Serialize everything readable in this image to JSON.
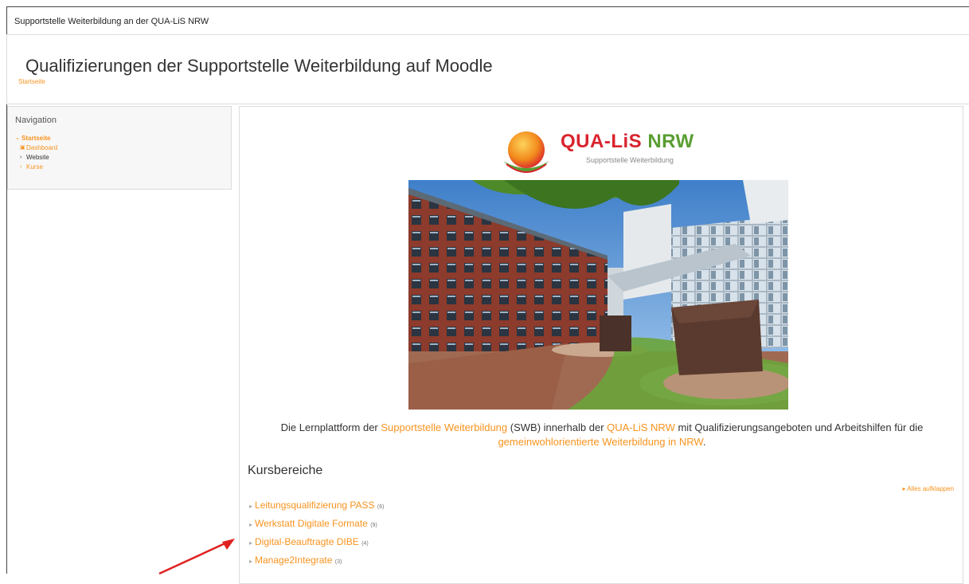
{
  "site_name": "Supportstelle Weiterbildung an der QUA-LiS NRW",
  "page_title": "Qualifizierungen der Supportstelle Weiterbildung auf Moodle",
  "breadcrumb": [
    "Startseite"
  ],
  "navigation": {
    "title": "Navigation",
    "items": [
      {
        "label": "Startseite",
        "glyph": "chevron-down-icon"
      },
      {
        "label": "Dashboard",
        "glyph": "dashboard-icon"
      },
      {
        "label": "Website",
        "glyph": "chevron-right-icon"
      },
      {
        "label": "Kurse",
        "glyph": "chevron-right-icon"
      }
    ]
  },
  "logo": {
    "text_primary": "QUA-LiS ",
    "text_accent": "NRW",
    "subtitle": "Supportstelle Weiterbildung"
  },
  "intro": {
    "t1": "Die Lernplattform der ",
    "link1": "Supportstelle Weiterbildung",
    "t2": " (SWB) innerhalb der ",
    "link2": "QUA-LiS NRW",
    "t3": " mit Qualifizierungsangeboten und Arbeitshilfen für die ",
    "link3": "gemeinwohlorientierte Weiterbildung in NRW",
    "t4": "."
  },
  "course_categories": {
    "heading": "Kursbereiche",
    "expand_all": "Alles aufklappen",
    "items": [
      {
        "name": "Leitungsqualifizierung PASS",
        "count": "(6)"
      },
      {
        "name": "Werkstatt Digitale Formate",
        "count": "(9)"
      },
      {
        "name": "Digital-Beauftragte DIBE",
        "count": "(4)"
      },
      {
        "name": "Manage2Integrate",
        "count": "(3)"
      }
    ]
  },
  "colors": {
    "accent": "#f7931e",
    "logo_red": "#d9232d",
    "logo_green": "#5a9e32",
    "annotation_arrow": "#e02020"
  }
}
